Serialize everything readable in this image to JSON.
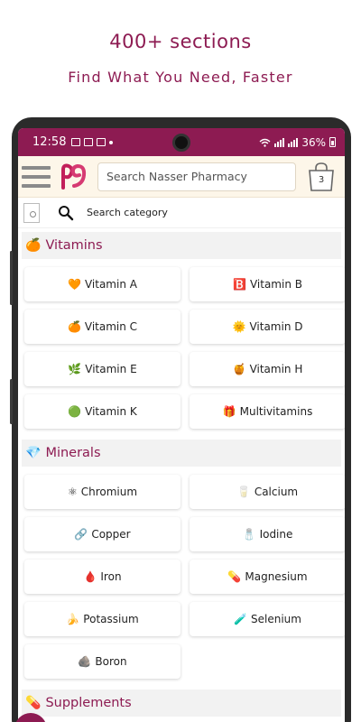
{
  "promo": {
    "title": "400+ sections",
    "subtitle": "Find What You Need, Faster"
  },
  "status_bar": {
    "time": "12:58",
    "battery": "36%"
  },
  "app_bar": {
    "search_placeholder": "Search Nasser Pharmacy",
    "cart_count": "3",
    "brand_color": "#8d1b52"
  },
  "category_search": {
    "label": "Search category"
  },
  "sections": [
    {
      "title": "Vitamins",
      "icon": "🍊",
      "items": [
        {
          "icon": "🧡",
          "label": "Vitamin A"
        },
        {
          "icon": "🅱️",
          "label": "Vitamin B"
        },
        {
          "icon": "🍊",
          "label": "Vitamin C"
        },
        {
          "icon": "🌞",
          "label": "Vitamin D"
        },
        {
          "icon": "🌿",
          "label": "Vitamin E"
        },
        {
          "icon": "🍯",
          "label": "Vitamin H"
        },
        {
          "icon": "🟢",
          "label": "Vitamin K"
        },
        {
          "icon": "🎁",
          "label": "Multivitamins"
        }
      ]
    },
    {
      "title": "Minerals",
      "icon": "💎",
      "items": [
        {
          "icon": "⚛",
          "label": "Chromium"
        },
        {
          "icon": "🥛",
          "label": "Calcium"
        },
        {
          "icon": "🔗",
          "label": "Copper"
        },
        {
          "icon": "🧂",
          "label": "Iodine"
        },
        {
          "icon": "🩸",
          "label": "Iron"
        },
        {
          "icon": "💊",
          "label": "Magnesium"
        },
        {
          "icon": "🍌",
          "label": "Potassium"
        },
        {
          "icon": "🧪",
          "label": "Selenium"
        },
        {
          "icon": "🪨",
          "label": "Boron"
        }
      ]
    },
    {
      "title": "Supplements",
      "icon": "💊",
      "items": []
    }
  ]
}
